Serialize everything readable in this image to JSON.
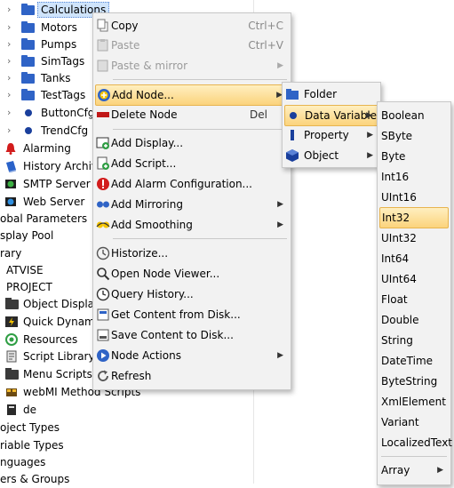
{
  "tree": {
    "items": [
      {
        "label": "Calculations",
        "icon": "folder-icon",
        "expander": "chevron-right-icon",
        "selected": true
      },
      {
        "label": "Motors",
        "icon": "folder-icon",
        "expander": "chevron-right-icon"
      },
      {
        "label": "Pumps",
        "icon": "folder-icon",
        "expander": "chevron-right-icon"
      },
      {
        "label": "SimTags",
        "icon": "folder-icon",
        "expander": "chevron-right-icon"
      },
      {
        "label": "Tanks",
        "icon": "folder-icon",
        "expander": "chevron-right-icon"
      },
      {
        "label": "TestTags",
        "icon": "folder-icon",
        "expander": "chevron-right-icon"
      },
      {
        "label": "ButtonCfg",
        "icon": "variable-dot-icon",
        "expander": "chevron-right-icon"
      },
      {
        "label": "TrendCfg",
        "icon": "variable-dot-icon",
        "expander": "chevron-right-icon"
      },
      {
        "label": "Alarming",
        "icon": "alarm-bell-icon"
      },
      {
        "label": "History Archive",
        "icon": "history-book-icon"
      },
      {
        "label": "SMTP Server",
        "icon": "smtp-server-icon"
      },
      {
        "label": "Web Server",
        "icon": "web-server-icon"
      },
      {
        "label": "obal Parameters"
      },
      {
        "label": "splay Pool"
      },
      {
        "label": "rary"
      },
      {
        "label": "ATVISE"
      },
      {
        "label": "PROJECT"
      },
      {
        "label": "Object Displays",
        "icon": "folder-icon"
      },
      {
        "label": "Quick Dynamics",
        "icon": "lightning-icon"
      },
      {
        "label": "Resources",
        "icon": "resources-icon"
      },
      {
        "label": "Script Library",
        "icon": "script-icon"
      },
      {
        "label": "Menu Scripts",
        "icon": "folder-icon"
      },
      {
        "label": "webMI Method Scripts",
        "icon": "method-scripts-icon"
      },
      {
        "label": "de",
        "icon": "document-icon"
      },
      {
        "label": "oject Types"
      },
      {
        "label": "riable Types"
      },
      {
        "label": "nguages"
      },
      {
        "label": "ers & Groups"
      }
    ]
  },
  "context_menu": {
    "items": [
      {
        "label": "Copy",
        "shortcut": "Ctrl+C",
        "icon": "copy-icon",
        "enabled": true
      },
      {
        "label": "Paste",
        "shortcut": "Ctrl+V",
        "icon": "paste-icon",
        "enabled": false
      },
      {
        "label": "Paste & mirror",
        "icon": "paste-mirror-icon",
        "enabled": false,
        "submenu": true
      },
      {
        "label": "Add Node...",
        "icon": "add-node-icon",
        "enabled": true,
        "submenu": true,
        "highlighted": true
      },
      {
        "label": "Delete Node",
        "shortcut": "Del",
        "icon": "delete-node-icon",
        "enabled": true
      },
      {
        "label": "Add Display...",
        "icon": "add-display-icon",
        "enabled": true
      },
      {
        "label": "Add Script...",
        "icon": "add-script-icon",
        "enabled": true
      },
      {
        "label": "Add Alarm Configuration...",
        "icon": "alarm-config-icon",
        "enabled": true
      },
      {
        "label": "Add Mirroring",
        "icon": "mirroring-icon",
        "enabled": true,
        "submenu": true
      },
      {
        "label": "Add Smoothing",
        "icon": "smoothing-icon",
        "enabled": true,
        "submenu": true
      },
      {
        "label": "Historize...",
        "icon": "historize-icon",
        "enabled": true
      },
      {
        "label": "Open Node Viewer...",
        "icon": "magnifier-icon",
        "enabled": true
      },
      {
        "label": "Query History...",
        "icon": "clock-icon",
        "enabled": true
      },
      {
        "label": "Get Content from Disk...",
        "icon": "get-content-icon",
        "enabled": true
      },
      {
        "label": "Save Content to Disk...",
        "icon": "save-content-icon",
        "enabled": true
      },
      {
        "label": "Node Actions",
        "icon": "node-actions-icon",
        "enabled": true,
        "submenu": true
      },
      {
        "label": "Refresh",
        "icon": "refresh-icon",
        "enabled": true
      }
    ]
  },
  "add_node_menu": {
    "items": [
      {
        "label": "Folder",
        "icon": "folder-icon"
      },
      {
        "label": "Data Variable",
        "icon": "variable-dot-icon",
        "submenu": true,
        "highlighted": true
      },
      {
        "label": "Property",
        "icon": "property-icon",
        "submenu": true
      },
      {
        "label": "Object",
        "icon": "object-cube-icon",
        "submenu": true
      }
    ]
  },
  "data_type_menu": {
    "items": [
      {
        "label": "Boolean"
      },
      {
        "label": "SByte"
      },
      {
        "label": "Byte"
      },
      {
        "label": "Int16"
      },
      {
        "label": "UInt16"
      },
      {
        "label": "Int32",
        "highlighted": true
      },
      {
        "label": "UInt32"
      },
      {
        "label": "Int64"
      },
      {
        "label": "UInt64"
      },
      {
        "label": "Float"
      },
      {
        "label": "Double"
      },
      {
        "label": "String"
      },
      {
        "label": "DateTime"
      },
      {
        "label": "ByteString"
      },
      {
        "label": "XmlElement"
      },
      {
        "label": "Variant"
      },
      {
        "label": "LocalizedText"
      },
      {
        "label": "Array",
        "submenu": true
      }
    ]
  },
  "colors": {
    "accent": "#2f63c6",
    "highlight_top": "#ffefc0",
    "highlight_bottom": "#fbd37c",
    "menu_bg": "#f2f2f2",
    "disabled_text": "#9b9b9b"
  }
}
